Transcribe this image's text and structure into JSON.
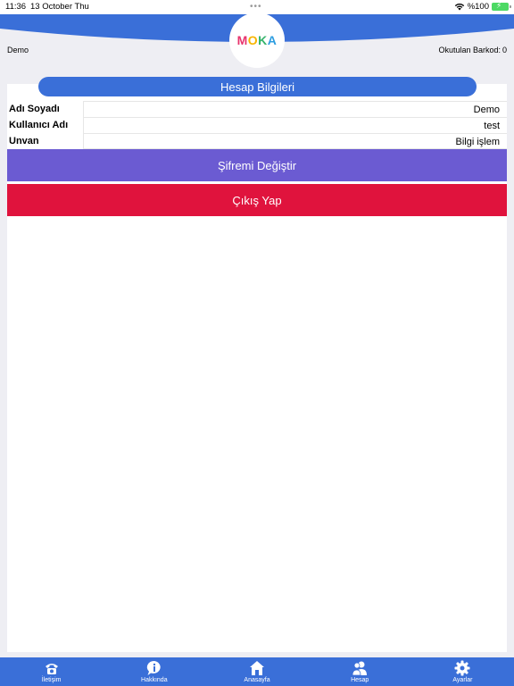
{
  "status_bar": {
    "time": "11:36",
    "date": "13 October Thu",
    "dots": "•••",
    "battery_text": "%100",
    "wifi_icon": "wifi-icon",
    "battery_icon": "battery-charging-icon"
  },
  "header": {
    "logo_letters": [
      "M",
      "O",
      "K",
      "A",
      ""
    ],
    "user_name": "Demo",
    "barcode_label": "Okutulan Barkod:",
    "barcode_count": "0",
    "brand_color": "#3a6fd8"
  },
  "account": {
    "section_title": "Hesap Bilgileri",
    "rows": [
      {
        "label": "Adı Soyadı",
        "value": "Demo"
      },
      {
        "label": "Kullanıcı Adı",
        "value": "test"
      },
      {
        "label": "Unvan",
        "value": "Bilgi işlem"
      }
    ],
    "change_password_label": "Şifremi Değiştir",
    "change_password_color": "#6b5bd2",
    "logout_label": "Çıkış Yap",
    "logout_color": "#e0133d"
  },
  "tabs": [
    {
      "label": "İletişim",
      "icon": "phone-icon"
    },
    {
      "label": "Hakkında",
      "icon": "info-icon"
    },
    {
      "label": "Anasayfa",
      "icon": "home-icon"
    },
    {
      "label": "Hesap",
      "icon": "users-icon"
    },
    {
      "label": "Ayarlar",
      "icon": "gear-icon"
    }
  ]
}
